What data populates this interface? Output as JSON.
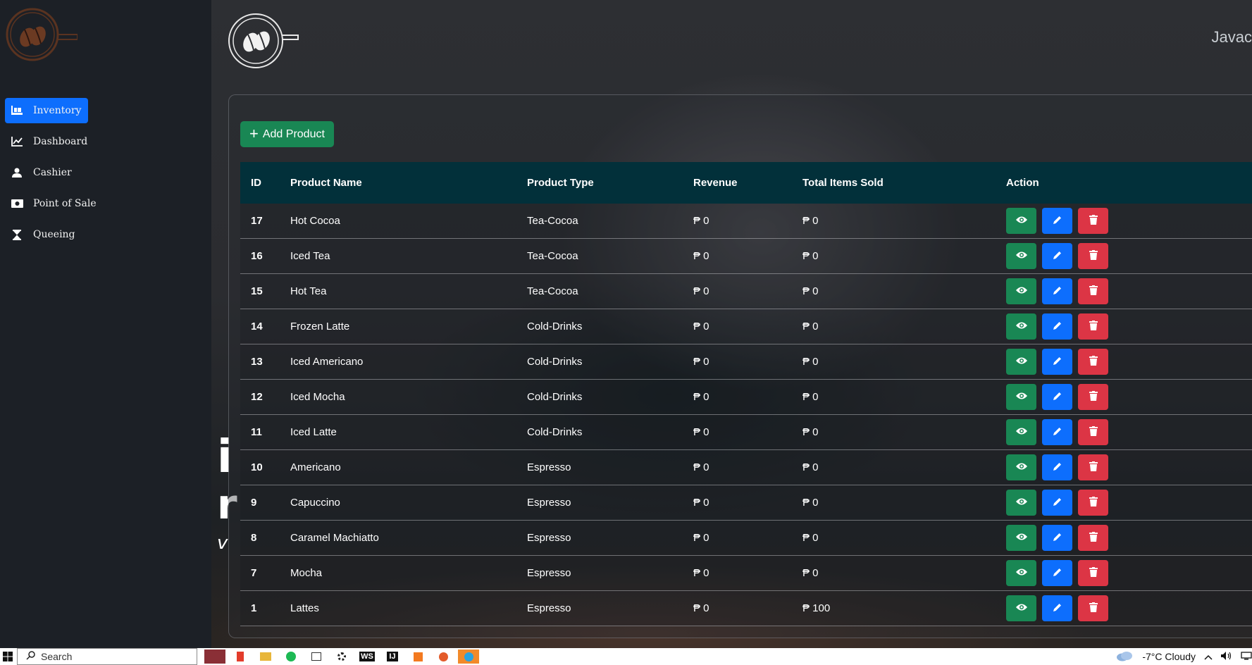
{
  "brand_text": "Javac",
  "background_overlay": {
    "line1": "i",
    "line2": "r",
    "line3": "v"
  },
  "sidebar": {
    "items": [
      {
        "label": "Inventory",
        "icon": "inventory-icon",
        "active": true
      },
      {
        "label": "Dashboard",
        "icon": "chart-line-icon",
        "active": false
      },
      {
        "label": "Cashier",
        "icon": "user-icon",
        "active": false
      },
      {
        "label": "Point of Sale",
        "icon": "money-bill-icon",
        "active": false
      },
      {
        "label": "Queeing",
        "icon": "hourglass-icon",
        "active": false
      }
    ]
  },
  "toolbar": {
    "add_label": "Add Product"
  },
  "table": {
    "headers": {
      "id": "ID",
      "name": "Product Name",
      "type": "Product Type",
      "revenue": "Revenue",
      "sold": "Total Items Sold",
      "action": "Action"
    },
    "rows": [
      {
        "id": "17",
        "name": "Hot Cocoa",
        "type": "Tea-Cocoa",
        "revenue": "₱ 0",
        "sold": "₱ 0"
      },
      {
        "id": "16",
        "name": "Iced Tea",
        "type": "Tea-Cocoa",
        "revenue": "₱ 0",
        "sold": "₱ 0"
      },
      {
        "id": "15",
        "name": "Hot Tea",
        "type": "Tea-Cocoa",
        "revenue": "₱ 0",
        "sold": "₱ 0"
      },
      {
        "id": "14",
        "name": "Frozen Latte",
        "type": "Cold-Drinks",
        "revenue": "₱ 0",
        "sold": "₱ 0"
      },
      {
        "id": "13",
        "name": "Iced Americano",
        "type": "Cold-Drinks",
        "revenue": "₱ 0",
        "sold": "₱ 0"
      },
      {
        "id": "12",
        "name": "Iced Mocha",
        "type": "Cold-Drinks",
        "revenue": "₱ 0",
        "sold": "₱ 0"
      },
      {
        "id": "11",
        "name": "Iced Latte",
        "type": "Cold-Drinks",
        "revenue": "₱ 0",
        "sold": "₱ 0"
      },
      {
        "id": "10",
        "name": "Americano",
        "type": "Espresso",
        "revenue": "₱ 0",
        "sold": "₱ 0"
      },
      {
        "id": "9",
        "name": "Capuccino",
        "type": "Espresso",
        "revenue": "₱ 0",
        "sold": "₱ 0"
      },
      {
        "id": "8",
        "name": "Caramel Machiatto",
        "type": "Espresso",
        "revenue": "₱ 0",
        "sold": "₱ 0"
      },
      {
        "id": "7",
        "name": "Mocha",
        "type": "Espresso",
        "revenue": "₱ 0",
        "sold": "₱ 0"
      },
      {
        "id": "1",
        "name": "Lattes",
        "type": "Espresso",
        "revenue": "₱ 0",
        "sold": "₱ 100"
      }
    ]
  },
  "taskbar": {
    "search_label": "Search",
    "weather": "-7°C  Cloudy",
    "apps": [
      "WS",
      "IJ"
    ]
  },
  "colors": {
    "primary": "#0d6efd",
    "success": "#198754",
    "danger": "#dc3545",
    "table_header": "#02303a",
    "sidebar": "#1c2026"
  }
}
